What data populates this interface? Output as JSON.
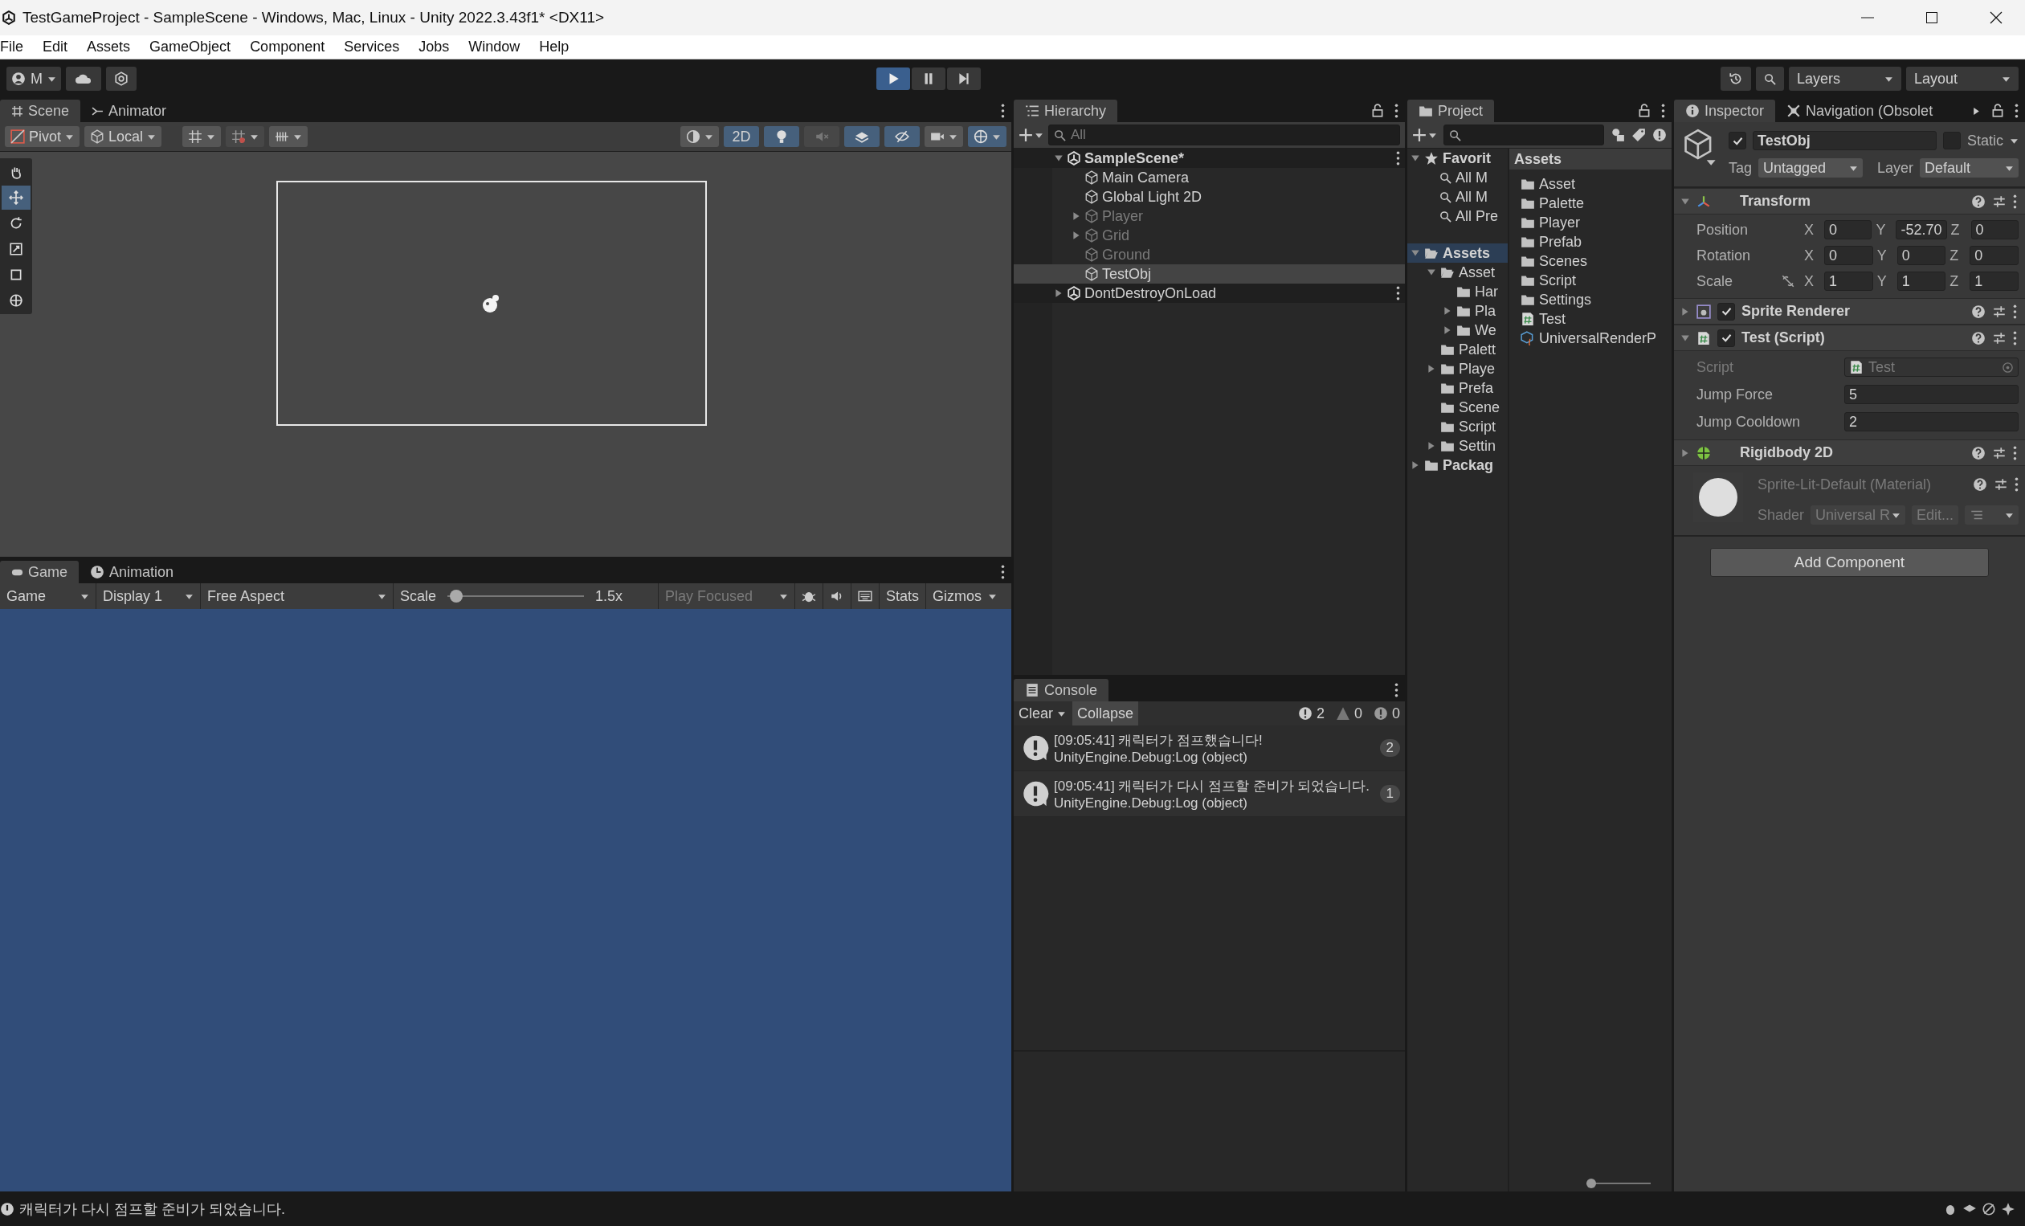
{
  "window": {
    "title": "TestGameProject - SampleScene - Windows, Mac, Linux - Unity 2022.3.43f1* <DX11>"
  },
  "menu": [
    "File",
    "Edit",
    "Assets",
    "GameObject",
    "Component",
    "Services",
    "Jobs",
    "Window",
    "Help"
  ],
  "toolbar": {
    "account": "M",
    "playmode": [
      {
        "kind": "play",
        "on": true
      },
      {
        "kind": "pause",
        "on": false
      },
      {
        "kind": "step",
        "on": false
      }
    ],
    "layers": "Layers",
    "layout": "Layout"
  },
  "scene_panel": {
    "tabs": [
      {
        "label": "Scene",
        "kind": "scene",
        "selected": true
      },
      {
        "label": "Animator",
        "kind": "animator",
        "selected": false
      }
    ],
    "pivot": "Pivot",
    "space": "Local",
    "toggles": [
      {
        "kind": "mode",
        "label": "2D",
        "on": true
      },
      {
        "kind": "light",
        "on": true
      },
      {
        "kind": "audio",
        "on": false
      },
      {
        "kind": "effects",
        "on": true
      },
      {
        "kind": "visibility",
        "on": true
      }
    ],
    "tools": [
      {
        "kind": "hand",
        "selected": false
      },
      {
        "kind": "move",
        "selected": true
      },
      {
        "kind": "rotate",
        "selected": false
      },
      {
        "kind": "scale",
        "selected": false
      },
      {
        "kind": "rect",
        "selected": false
      },
      {
        "kind": "transform",
        "selected": false
      }
    ]
  },
  "game_panel": {
    "tabs": [
      {
        "label": "Game",
        "kind": "game",
        "selected": true
      },
      {
        "label": "Animation",
        "kind": "animation",
        "selected": false
      }
    ],
    "view": "Game",
    "display": "Display 1",
    "aspect": "Free Aspect",
    "scale_label": "Scale",
    "scale": {
      "level": 0.02
    },
    "scale_value": "1.5x",
    "play_focused": "Play Focused",
    "stats": "Stats",
    "gizmos": "Gizmos"
  },
  "hierarchy": {
    "tabs": [
      {
        "label": "Hierarchy",
        "kind": "hierarchy",
        "selected": true
      }
    ],
    "placeholder": "All",
    "items": [
      {
        "name": "SampleScene*",
        "kind": "scene",
        "expanded": true,
        "selected": false,
        "disabled": false,
        "children": [
          {
            "name": "Main Camera",
            "kind": "object",
            "selected": false,
            "disabled": false
          },
          {
            "name": "Global Light 2D",
            "kind": "object",
            "selected": false,
            "disabled": false
          },
          {
            "name": "Player",
            "kind": "object",
            "expanded": false,
            "selected": false,
            "disabled": true
          },
          {
            "name": "Grid",
            "kind": "object",
            "expanded": false,
            "selected": false,
            "disabled": true
          },
          {
            "name": "Ground",
            "kind": "object",
            "selected": false,
            "disabled": true
          },
          {
            "name": "TestObj",
            "kind": "object",
            "selected": true,
            "disabled": false
          }
        ]
      },
      {
        "name": "DontDestroyOnLoad",
        "kind": "scene",
        "expanded": false,
        "selected": false,
        "disabled": false
      }
    ]
  },
  "project": {
    "tabs": [
      {
        "label": "Project",
        "kind": "project",
        "selected": true
      }
    ],
    "zoom": {
      "level": 0.0
    },
    "favorites": {
      "name": "Favorit",
      "expanded": true,
      "children": [
        {
          "name": "All M"
        },
        {
          "name": "All M"
        },
        {
          "name": "All Pre"
        }
      ]
    },
    "tree": [
      {
        "name": "Assets",
        "expanded": true,
        "selected": true,
        "children": [
          {
            "name": "Asset",
            "expanded": true,
            "selected": false,
            "children": [
              {
                "name": "Har",
                "selected": false
              },
              {
                "name": "Pla",
                "expanded": false,
                "selected": false
              },
              {
                "name": "We",
                "expanded": false,
                "selected": false
              }
            ]
          },
          {
            "name": "Palett",
            "selected": false
          },
          {
            "name": "Playe",
            "expanded": false,
            "selected": false
          },
          {
            "name": "Prefa",
            "selected": false
          },
          {
            "name": "Scene",
            "selected": false
          },
          {
            "name": "Script",
            "selected": false
          },
          {
            "name": "Settin",
            "expanded": false,
            "selected": false
          }
        ]
      },
      {
        "name": "Packag",
        "expanded": false,
        "selected": false
      }
    ],
    "breadcrumb": "Assets",
    "items": [
      {
        "name": "Asset",
        "kind": "folder"
      },
      {
        "name": "Palette",
        "kind": "folder"
      },
      {
        "name": "Player",
        "kind": "folder"
      },
      {
        "name": "Prefab",
        "kind": "folder"
      },
      {
        "name": "Scenes",
        "kind": "folder"
      },
      {
        "name": "Script",
        "kind": "folder"
      },
      {
        "name": "Settings",
        "kind": "folder"
      },
      {
        "name": "Test",
        "kind": "script"
      },
      {
        "name": "UniversalRenderP",
        "kind": "pipeline"
      }
    ]
  },
  "inspector": {
    "tabs": [
      {
        "label": "Inspector",
        "kind": "info",
        "selected": true
      },
      {
        "label": "Navigation (Obsolet",
        "kind": "navigation",
        "selected": false
      }
    ],
    "object": {
      "active": true,
      "name": "TestObj",
      "static": false,
      "static_label": "Static",
      "tag_label": "Tag",
      "tag": "Untagged",
      "layer_label": "Layer",
      "layer": "Default"
    },
    "components": [
      {
        "kind": "transform",
        "title": "Transform",
        "expanded": true,
        "rows": [
          {
            "label": "Position",
            "values": [
              {
                "axis": "X",
                "value": "0"
              },
              {
                "axis": "Y",
                "value": "-52.70"
              },
              {
                "axis": "Z",
                "value": "0"
              }
            ]
          },
          {
            "label": "Rotation",
            "values": [
              {
                "axis": "X",
                "value": "0"
              },
              {
                "axis": "Y",
                "value": "0"
              },
              {
                "axis": "Z",
                "value": "0"
              }
            ]
          },
          {
            "label": "Scale",
            "values": [
              {
                "axis": "X",
                "value": "1"
              },
              {
                "axis": "Y",
                "value": "1"
              },
              {
                "axis": "Z",
                "value": "1"
              }
            ]
          }
        ]
      },
      {
        "kind": "sprite_renderer",
        "title": "Sprite Renderer",
        "expanded": false,
        "enabled": true
      },
      {
        "kind": "script",
        "title": "Test (Script)",
        "expanded": true,
        "enabled": true,
        "fields": [
          {
            "label": "Script",
            "value": "Test",
            "disabled": true
          },
          {
            "label": "Jump Force",
            "value": "5",
            "disabled": false
          },
          {
            "label": "Jump Cooldown",
            "value": "2",
            "disabled": false
          }
        ]
      },
      {
        "kind": "rigidbody",
        "title": "Rigidbody 2D",
        "expanded": false
      }
    ],
    "material": {
      "title": "Sprite-Lit-Default (Material)",
      "shader_label": "Shader",
      "shader": "Universal R",
      "edit": "Edit..."
    },
    "add_component": "Add Component"
  },
  "console": {
    "tabs": [
      {
        "label": "Console",
        "kind": "console",
        "selected": true
      }
    ],
    "clear": "Clear",
    "collapse": "Collapse",
    "counts": [
      {
        "kind": "info",
        "count": "2"
      },
      {
        "kind": "warning",
        "count": "0"
      },
      {
        "kind": "error",
        "count": "0"
      }
    ],
    "entries": [
      {
        "message": "[09:05:41] 캐릭터가 점프했습니다!",
        "source": "UnityEngine.Debug:Log (object)",
        "count": "2"
      },
      {
        "message": "[09:05:41] 캐릭터가 다시 점프할 준비가 되었습니다.",
        "source": "UnityEngine.Debug:Log (object)",
        "count": "1"
      }
    ]
  },
  "status_bar": {
    "message": "캐릭터가 다시 점프할 준비가 되었습니다."
  }
}
